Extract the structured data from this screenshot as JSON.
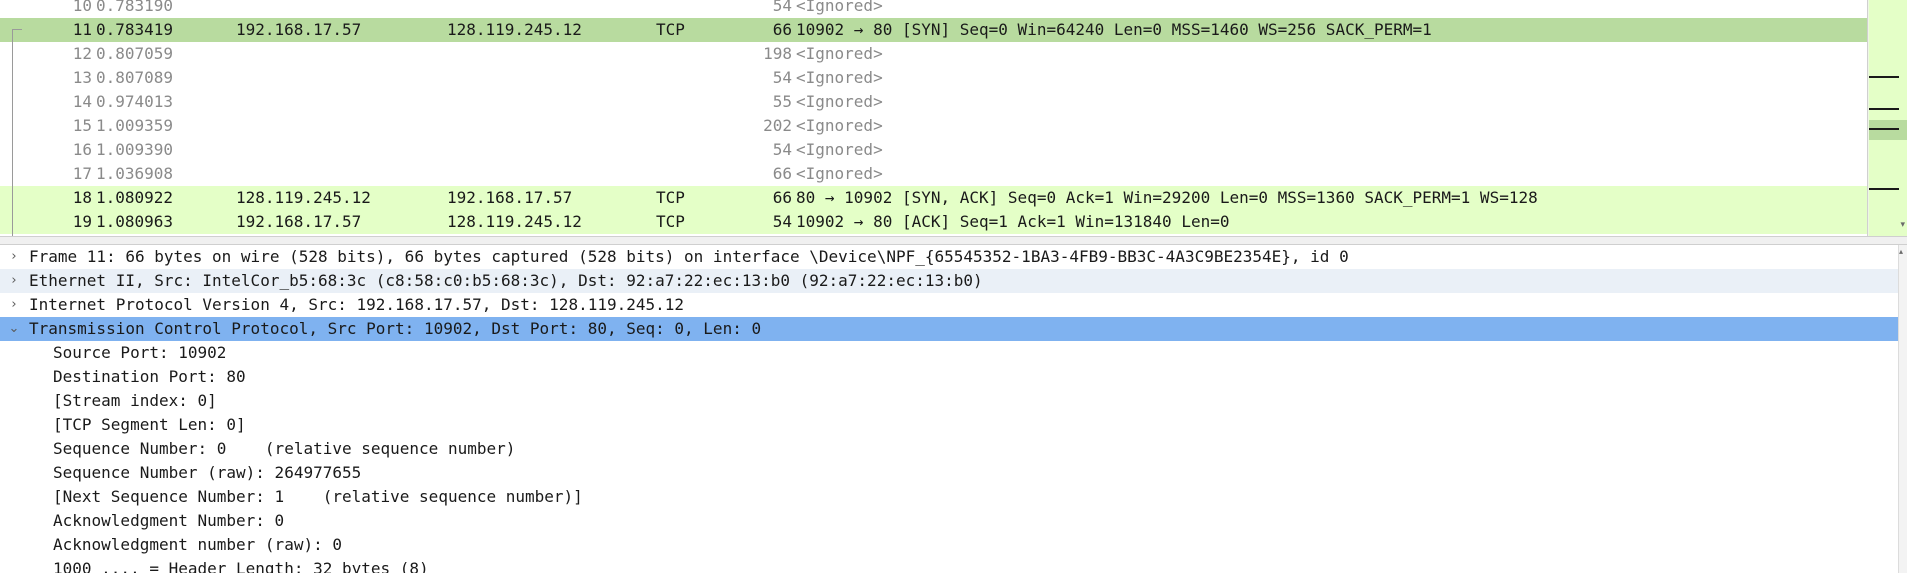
{
  "packet_list": {
    "rows": [
      {
        "no": "10",
        "time": "0.783190",
        "source": "",
        "destination": "",
        "protocol": "",
        "length": "54",
        "info": "<Ignored>",
        "style": "plain"
      },
      {
        "no": "11",
        "time": "0.783419",
        "source": "192.168.17.57",
        "destination": "128.119.245.12",
        "protocol": "TCP",
        "length": "66",
        "info": "10902 → 80 [SYN] Seq=0 Win=64240 Len=0 MSS=1460 WS=256 SACK_PERM=1",
        "style": "selected"
      },
      {
        "no": "12",
        "time": "0.807059",
        "source": "",
        "destination": "",
        "protocol": "",
        "length": "198",
        "info": "<Ignored>",
        "style": "plain"
      },
      {
        "no": "13",
        "time": "0.807089",
        "source": "",
        "destination": "",
        "protocol": "",
        "length": "54",
        "info": "<Ignored>",
        "style": "plain"
      },
      {
        "no": "14",
        "time": "0.974013",
        "source": "",
        "destination": "",
        "protocol": "",
        "length": "55",
        "info": "<Ignored>",
        "style": "plain"
      },
      {
        "no": "15",
        "time": "1.009359",
        "source": "",
        "destination": "",
        "protocol": "",
        "length": "202",
        "info": "<Ignored>",
        "style": "plain"
      },
      {
        "no": "16",
        "time": "1.009390",
        "source": "",
        "destination": "",
        "protocol": "",
        "length": "54",
        "info": "<Ignored>",
        "style": "plain"
      },
      {
        "no": "17",
        "time": "1.036908",
        "source": "",
        "destination": "",
        "protocol": "",
        "length": "66",
        "info": "<Ignored>",
        "style": "plain"
      },
      {
        "no": "18",
        "time": "1.080922",
        "source": "128.119.245.12",
        "destination": "192.168.17.57",
        "protocol": "TCP",
        "length": "66",
        "info": "80 → 10902 [SYN, ACK] Seq=0 Ack=1 Win=29200 Len=0 MSS=1360 SACK_PERM=1 WS=128",
        "style": "tcp"
      },
      {
        "no": "19",
        "time": "1.080963",
        "source": "192.168.17.57",
        "destination": "128.119.245.12",
        "protocol": "TCP",
        "length": "54",
        "info": "10902 → 80 [ACK] Seq=1 Ack=1 Win=131840 Len=0",
        "style": "tcp"
      }
    ]
  },
  "packet_details": {
    "rows": [
      {
        "arrow": "›",
        "text": "Frame 11: 66 bytes on wire (528 bits), 66 bytes captured (528 bits) on interface \\Device\\NPF_{65545352-1BA3-4FB9-BB3C-4A3C9BE2354E}, id 0",
        "style": "top",
        "name": "detail-frame"
      },
      {
        "arrow": "›",
        "text": "Ethernet II, Src: IntelCor_b5:68:3c (c8:58:c0:b5:68:3c), Dst: 92:a7:22:ec:13:b0 (92:a7:22:ec:13:b0)",
        "style": "alt",
        "name": "detail-ethernet"
      },
      {
        "arrow": "›",
        "text": "Internet Protocol Version 4, Src: 192.168.17.57, Dst: 128.119.245.12",
        "style": "top",
        "name": "detail-ipv4"
      },
      {
        "arrow": "⌄",
        "text": "Transmission Control Protocol, Src Port: 10902, Dst Port: 80, Seq: 0, Len: 0",
        "style": "selected",
        "name": "detail-tcp"
      },
      {
        "arrow": "",
        "text": "Source Port: 10902",
        "style": "child",
        "name": "detail-source-port"
      },
      {
        "arrow": "",
        "text": "Destination Port: 80",
        "style": "child",
        "name": "detail-destination-port"
      },
      {
        "arrow": "",
        "text": "[Stream index: 0]",
        "style": "child",
        "name": "detail-stream-index"
      },
      {
        "arrow": "",
        "text": "[TCP Segment Len: 0]",
        "style": "child",
        "name": "detail-segment-len"
      },
      {
        "arrow": "",
        "text": "Sequence Number: 0    (relative sequence number)",
        "style": "child",
        "name": "detail-seq-number"
      },
      {
        "arrow": "",
        "text": "Sequence Number (raw): 264977655",
        "style": "child",
        "name": "detail-seq-raw"
      },
      {
        "arrow": "",
        "text": "[Next Sequence Number: 1    (relative sequence number)]",
        "style": "child",
        "name": "detail-next-seq"
      },
      {
        "arrow": "",
        "text": "Acknowledgment Number: 0",
        "style": "child",
        "name": "detail-ack-number"
      },
      {
        "arrow": "",
        "text": "Acknowledgment number (raw): 0",
        "style": "child",
        "name": "detail-ack-raw"
      },
      {
        "arrow": "",
        "text": "1000 .... = Header Length: 32 bytes (8)",
        "style": "child",
        "name": "detail-header-length"
      }
    ]
  },
  "colors": {
    "tcp_row": "#e4ffc7",
    "selected_packet": "#b8db9f",
    "selected_detail": "#7fb2f0",
    "alt_detail": "#eaf0f7"
  }
}
